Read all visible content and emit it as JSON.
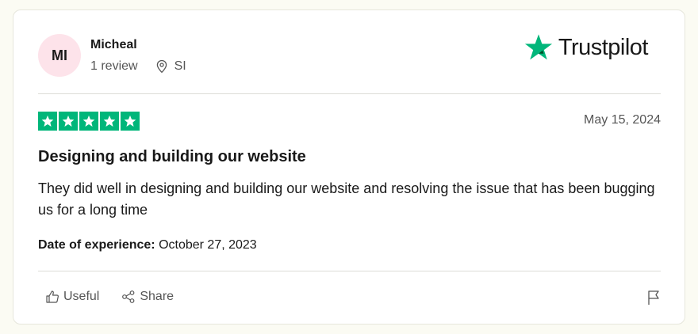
{
  "reviewer": {
    "initials": "MI",
    "name": "Micheal",
    "review_count": "1 review",
    "location": "SI"
  },
  "brand": {
    "name": "Trustpilot"
  },
  "review": {
    "rating": 5,
    "date": "May 15, 2024",
    "title": "Designing and building our website",
    "body": "They did well in designing and building our website and resolving the issue that has been bugging us for a long time",
    "experience_label": "Date of experience:",
    "experience_date": "October 27, 2023"
  },
  "actions": {
    "useful_label": "Useful",
    "share_label": "Share"
  },
  "icons": [
    "location-pin-icon",
    "trustpilot-star-icon",
    "star-icon",
    "thumbs-up-icon",
    "share-icon",
    "flag-icon"
  ],
  "colors": {
    "star_green": "#00b67a",
    "avatar_bg": "#fde3ea"
  }
}
